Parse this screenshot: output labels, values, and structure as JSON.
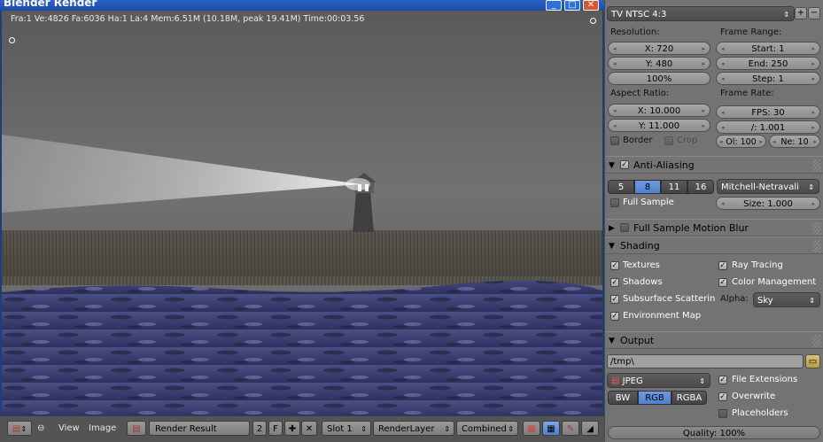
{
  "window": {
    "title": "Blender Render",
    "stats": "Fra:1  Ve:4826 Fa:6036 Ha:1 La:4 Mem:6.51M (10.18M, peak 19.41M) Time:00:03.56"
  },
  "bottom_bar": {
    "view_menu": "View",
    "image_menu": "Image",
    "image_name": "Render Result",
    "users": "2",
    "fake_user": "F",
    "slot": "Slot 1",
    "render_layer": "RenderLayer",
    "pass": "Combined"
  },
  "properties": {
    "preset": "TV NTSC 4:3",
    "resolution": {
      "label": "Resolution:",
      "x": "X: 720",
      "y": "Y: 480",
      "percent": "100%"
    },
    "frame_range": {
      "label": "Frame Range:",
      "start": "Start: 1",
      "end": "End: 250",
      "step": "Step: 1"
    },
    "aspect": {
      "label": "Aspect Ratio:",
      "x": "X: 10.000",
      "y": "Y: 11.000"
    },
    "frame_rate": {
      "label": "Frame Rate:",
      "fps": "FPS: 30",
      "base": "/: 1.001",
      "old": "Ol: 100",
      "new": "Ne: 10"
    },
    "border": "Border",
    "crop": "Crop",
    "anti_aliasing": {
      "title": "Anti-Aliasing",
      "samples": [
        "5",
        "8",
        "11",
        "16"
      ],
      "active_sample": "8",
      "filter": "Mitchell-Netravali",
      "full_sample": "Full Sample",
      "size": "Size: 1.000"
    },
    "motion_blur": {
      "title": "Full Sample Motion Blur"
    },
    "shading": {
      "title": "Shading",
      "textures": "Textures",
      "ray_tracing": "Ray Tracing",
      "shadows": "Shadows",
      "color_management": "Color Management",
      "sss": "Subsurface Scatterin",
      "alpha_label": "Alpha:",
      "alpha_value": "Sky",
      "env_map": "Environment Map"
    },
    "output": {
      "title": "Output",
      "path": "/tmp\\",
      "format": "JPEG",
      "modes": [
        "BW",
        "RGB",
        "RGBA"
      ],
      "active_mode": "RGB",
      "file_extensions": "File Extensions",
      "overwrite": "Overwrite",
      "placeholders": "Placeholders",
      "quality": "Quality: 100%"
    }
  }
}
